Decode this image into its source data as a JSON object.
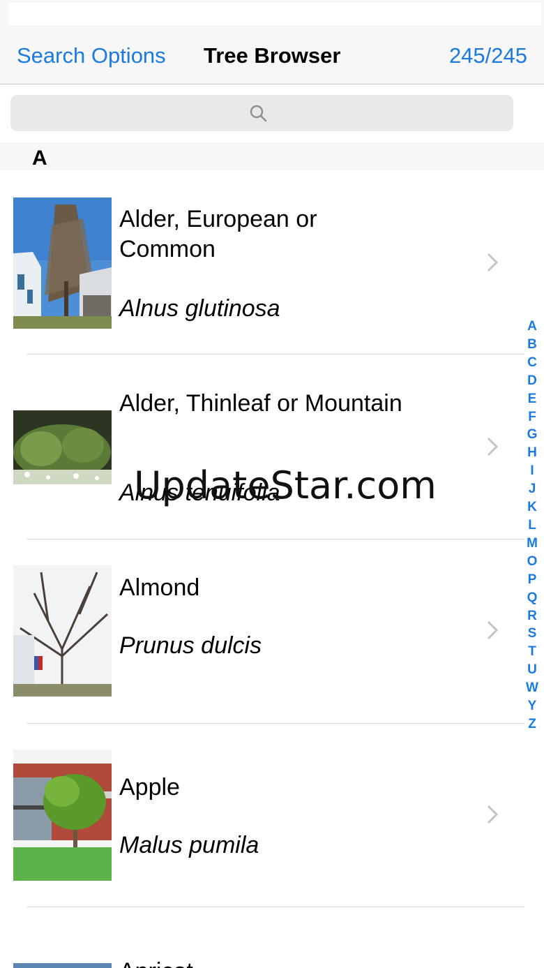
{
  "navbar": {
    "left_label": "Search Options",
    "title": "Tree Browser",
    "count": "245/245"
  },
  "search": {
    "placeholder": ""
  },
  "section": {
    "letter": "A"
  },
  "trees": [
    {
      "common": "Alder, European or Common",
      "latin": "Alnus glutinosa"
    },
    {
      "common": "Alder, Thinleaf or Mountain",
      "latin": "Alnus tenuifolia"
    },
    {
      "common": "Almond",
      "latin": "Prunus dulcis"
    },
    {
      "common": "Apple",
      "latin": "Malus pumila"
    },
    {
      "common": "Apricot",
      "latin": ""
    }
  ],
  "index": [
    "A",
    "B",
    "C",
    "D",
    "E",
    "F",
    "G",
    "H",
    "I",
    "J",
    "K",
    "L",
    "M",
    "O",
    "P",
    "Q",
    "R",
    "S",
    "T",
    "U",
    "W",
    "Y",
    "Z"
  ],
  "watermark": "UpdateStar.com",
  "colors": {
    "accent": "#1a7ae0",
    "bar": "#f7f7f7",
    "separator": "#d9d9dd"
  }
}
